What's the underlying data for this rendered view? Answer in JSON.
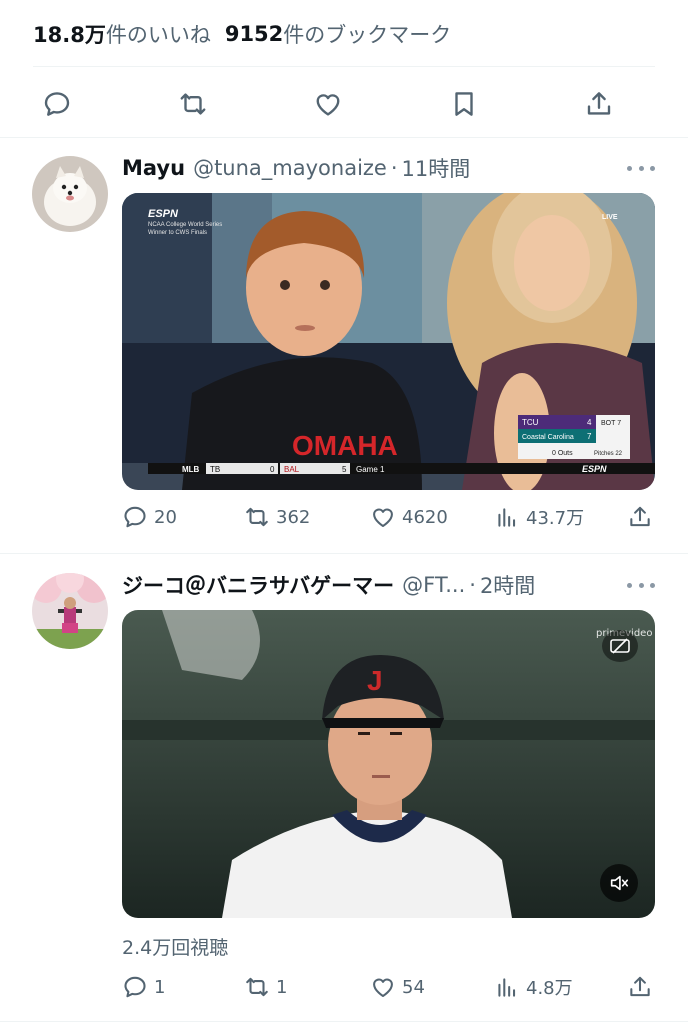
{
  "top_stats": {
    "likes_value": "18.8万",
    "likes_label": "件のいいね",
    "bookmarks_value": "9152",
    "bookmarks_label": "件のブックマーク"
  },
  "action_bar": {
    "icons": [
      "reply-icon",
      "retweet-icon",
      "like-icon",
      "bookmark-icon",
      "share-icon"
    ]
  },
  "tweets": [
    {
      "display_name": "Mayu",
      "handle": "@tuna_mayonaize",
      "separator": "·",
      "time": "11時間",
      "media": {
        "network_logo": "ESPN",
        "event_caption_1": "NCAA College World Series",
        "event_caption_2": "Winner to CWS Finals",
        "live_tag": "LIVE",
        "shirt_text": "OMAHA",
        "score": {
          "team1": "TCU",
          "team1_score": "4",
          "team2": "Coastal Carolina",
          "team2_score": "7",
          "inning": "BOT 7",
          "outs": "0 Outs",
          "pitches": "Pitches 22"
        },
        "ticker": {
          "league": "MLB",
          "away": "TB",
          "away_score": "0",
          "home": "BAL",
          "home_score": "5",
          "game": "Game 1",
          "logo": "ESPN"
        }
      },
      "replies": "20",
      "retweets": "362",
      "likes": "4620",
      "views": "43.7万"
    },
    {
      "display_name": "ジーコ＠バニラサバゲーマー",
      "handle": "@FT...",
      "separator": "·",
      "time": "2時間",
      "media": {
        "helmet_letter": "J",
        "watermark": "primevideo"
      },
      "view_count_text": "2.4万回視聴",
      "replies": "1",
      "retweets": "1",
      "likes": "54",
      "views": "4.8万"
    }
  ],
  "colors": {
    "text_primary": "#0f1419",
    "text_secondary": "#536471",
    "divider": "#eff3f4"
  }
}
